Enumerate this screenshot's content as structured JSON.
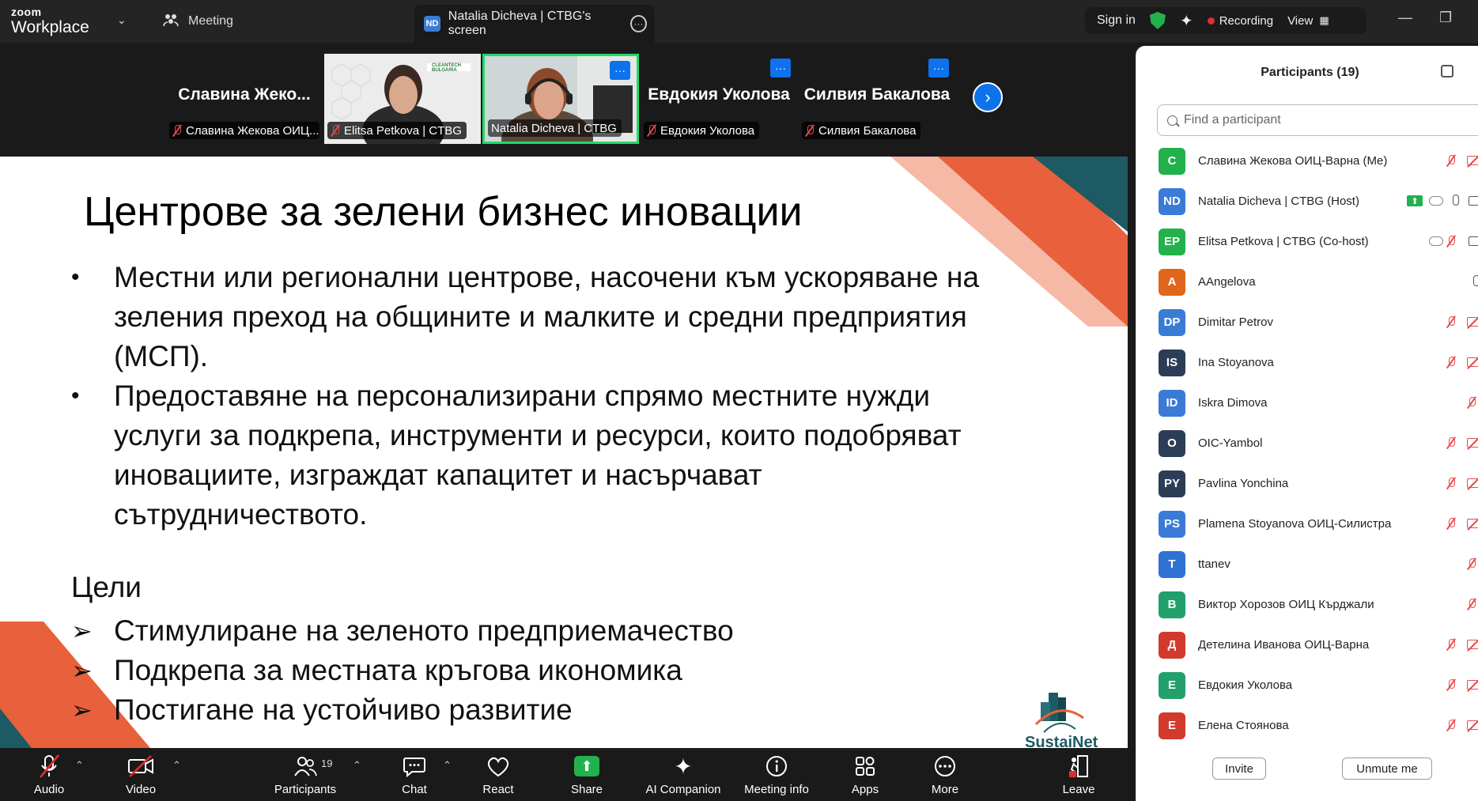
{
  "topbar": {
    "logo_line1": "zoom",
    "logo_line2": "Workplace",
    "meeting_label": "Meeting",
    "screen_tab_initials": "ND",
    "screen_tab_label": "Natalia Dicheva | CTBG's screen",
    "sign_in": "Sign in",
    "recording": "Recording",
    "view": "View"
  },
  "strip": {
    "tiles": [
      {
        "big_name": "Славина Жеко...",
        "label": "Славина Жекова ОИЦ..."
      },
      {
        "label": "Elitsa Petkova | CTBG",
        "logo_text": "CLEANTECH BULGARIA"
      },
      {
        "label": "Natalia Dicheva | CTBG"
      },
      {
        "big_name": "Евдокия Уколова",
        "label": "Евдокия Уколова"
      },
      {
        "big_name": "Силвия Бакалова",
        "label": "Силвия Бакалова"
      }
    ],
    "more_glyph": "···",
    "next_arrow": "›"
  },
  "slide": {
    "title": "Центрове за зелени бизнес иновации",
    "bullets": [
      "Местни или регионални центрове, насочени към ускоряване на зеления преход на общините и малките и средни предприятия (МСП).",
      "Предоставяне на персонализирани спрямо местните нужди услуги за подкрепа, инструменти и ресурси, които подобряват иновациите, изграждат капацитет и насърчават сътрудничеството."
    ],
    "goals_heading": "Цели",
    "goals": [
      "Стимулиране на зеленото предприемачество",
      "Подкрепа за местната кръгова икономика",
      "Постигане на устойчиво развитие"
    ],
    "logo_text": "SustaiNet",
    "colors": {
      "accent": "#e8603c",
      "teal": "#1e5a63"
    }
  },
  "toolbar": {
    "audio": "Audio",
    "video": "Video",
    "participants": "Participants",
    "participants_count": "19",
    "chat": "Chat",
    "react": "React",
    "share": "Share",
    "ai_companion": "AI Companion",
    "meeting_info": "Meeting info",
    "apps": "Apps",
    "more": "More",
    "leave": "Leave"
  },
  "panel": {
    "title": "Participants (19)",
    "search_placeholder": "Find a participant",
    "participants": [
      {
        "initials": "С",
        "name": "Славина Жекова ОИЦ-Варна (Me)",
        "color": "#22b14c"
      },
      {
        "initials": "ND",
        "name": "Natalia Dicheva | CTBG (Host)",
        "color": "#3a7bd5"
      },
      {
        "initials": "EP",
        "name": "Elitsa Petkova | CTBG (Co-host)",
        "color": "#22b14c"
      },
      {
        "initials": "A",
        "name": "AAngelova",
        "color": "#e0661b"
      },
      {
        "initials": "DP",
        "name": "Dimitar Petrov",
        "color": "#3a7bd5"
      },
      {
        "initials": "IS",
        "name": "Ina Stoyanova",
        "color": "#2c3e57"
      },
      {
        "initials": "ID",
        "name": "Iskra Dimova",
        "color": "#3a7bd5"
      },
      {
        "initials": "O",
        "name": "OIC-Yambol",
        "color": "#2c3e57"
      },
      {
        "initials": "PY",
        "name": "Pavlina Yonchina",
        "color": "#2c3e57"
      },
      {
        "initials": "PS",
        "name": "Plamena Stoyanova ОИЦ-Силистра",
        "color": "#3a7bd5"
      },
      {
        "initials": "T",
        "name": "ttanev",
        "color": "#2e72d2"
      },
      {
        "initials": "В",
        "name": "Виктор Хорозов ОИЦ Кърджали",
        "color": "#22a06b"
      },
      {
        "initials": "Д",
        "name": "Детелина Иванова ОИЦ-Варна",
        "color": "#d23a2e"
      },
      {
        "initials": "Е",
        "name": "Евдокия Уколова",
        "color": "#22a06b"
      },
      {
        "initials": "Е",
        "name": "Елена Стоянова",
        "color": "#d23a2e"
      }
    ],
    "invite": "Invite",
    "unmute_me": "Unmute me"
  }
}
